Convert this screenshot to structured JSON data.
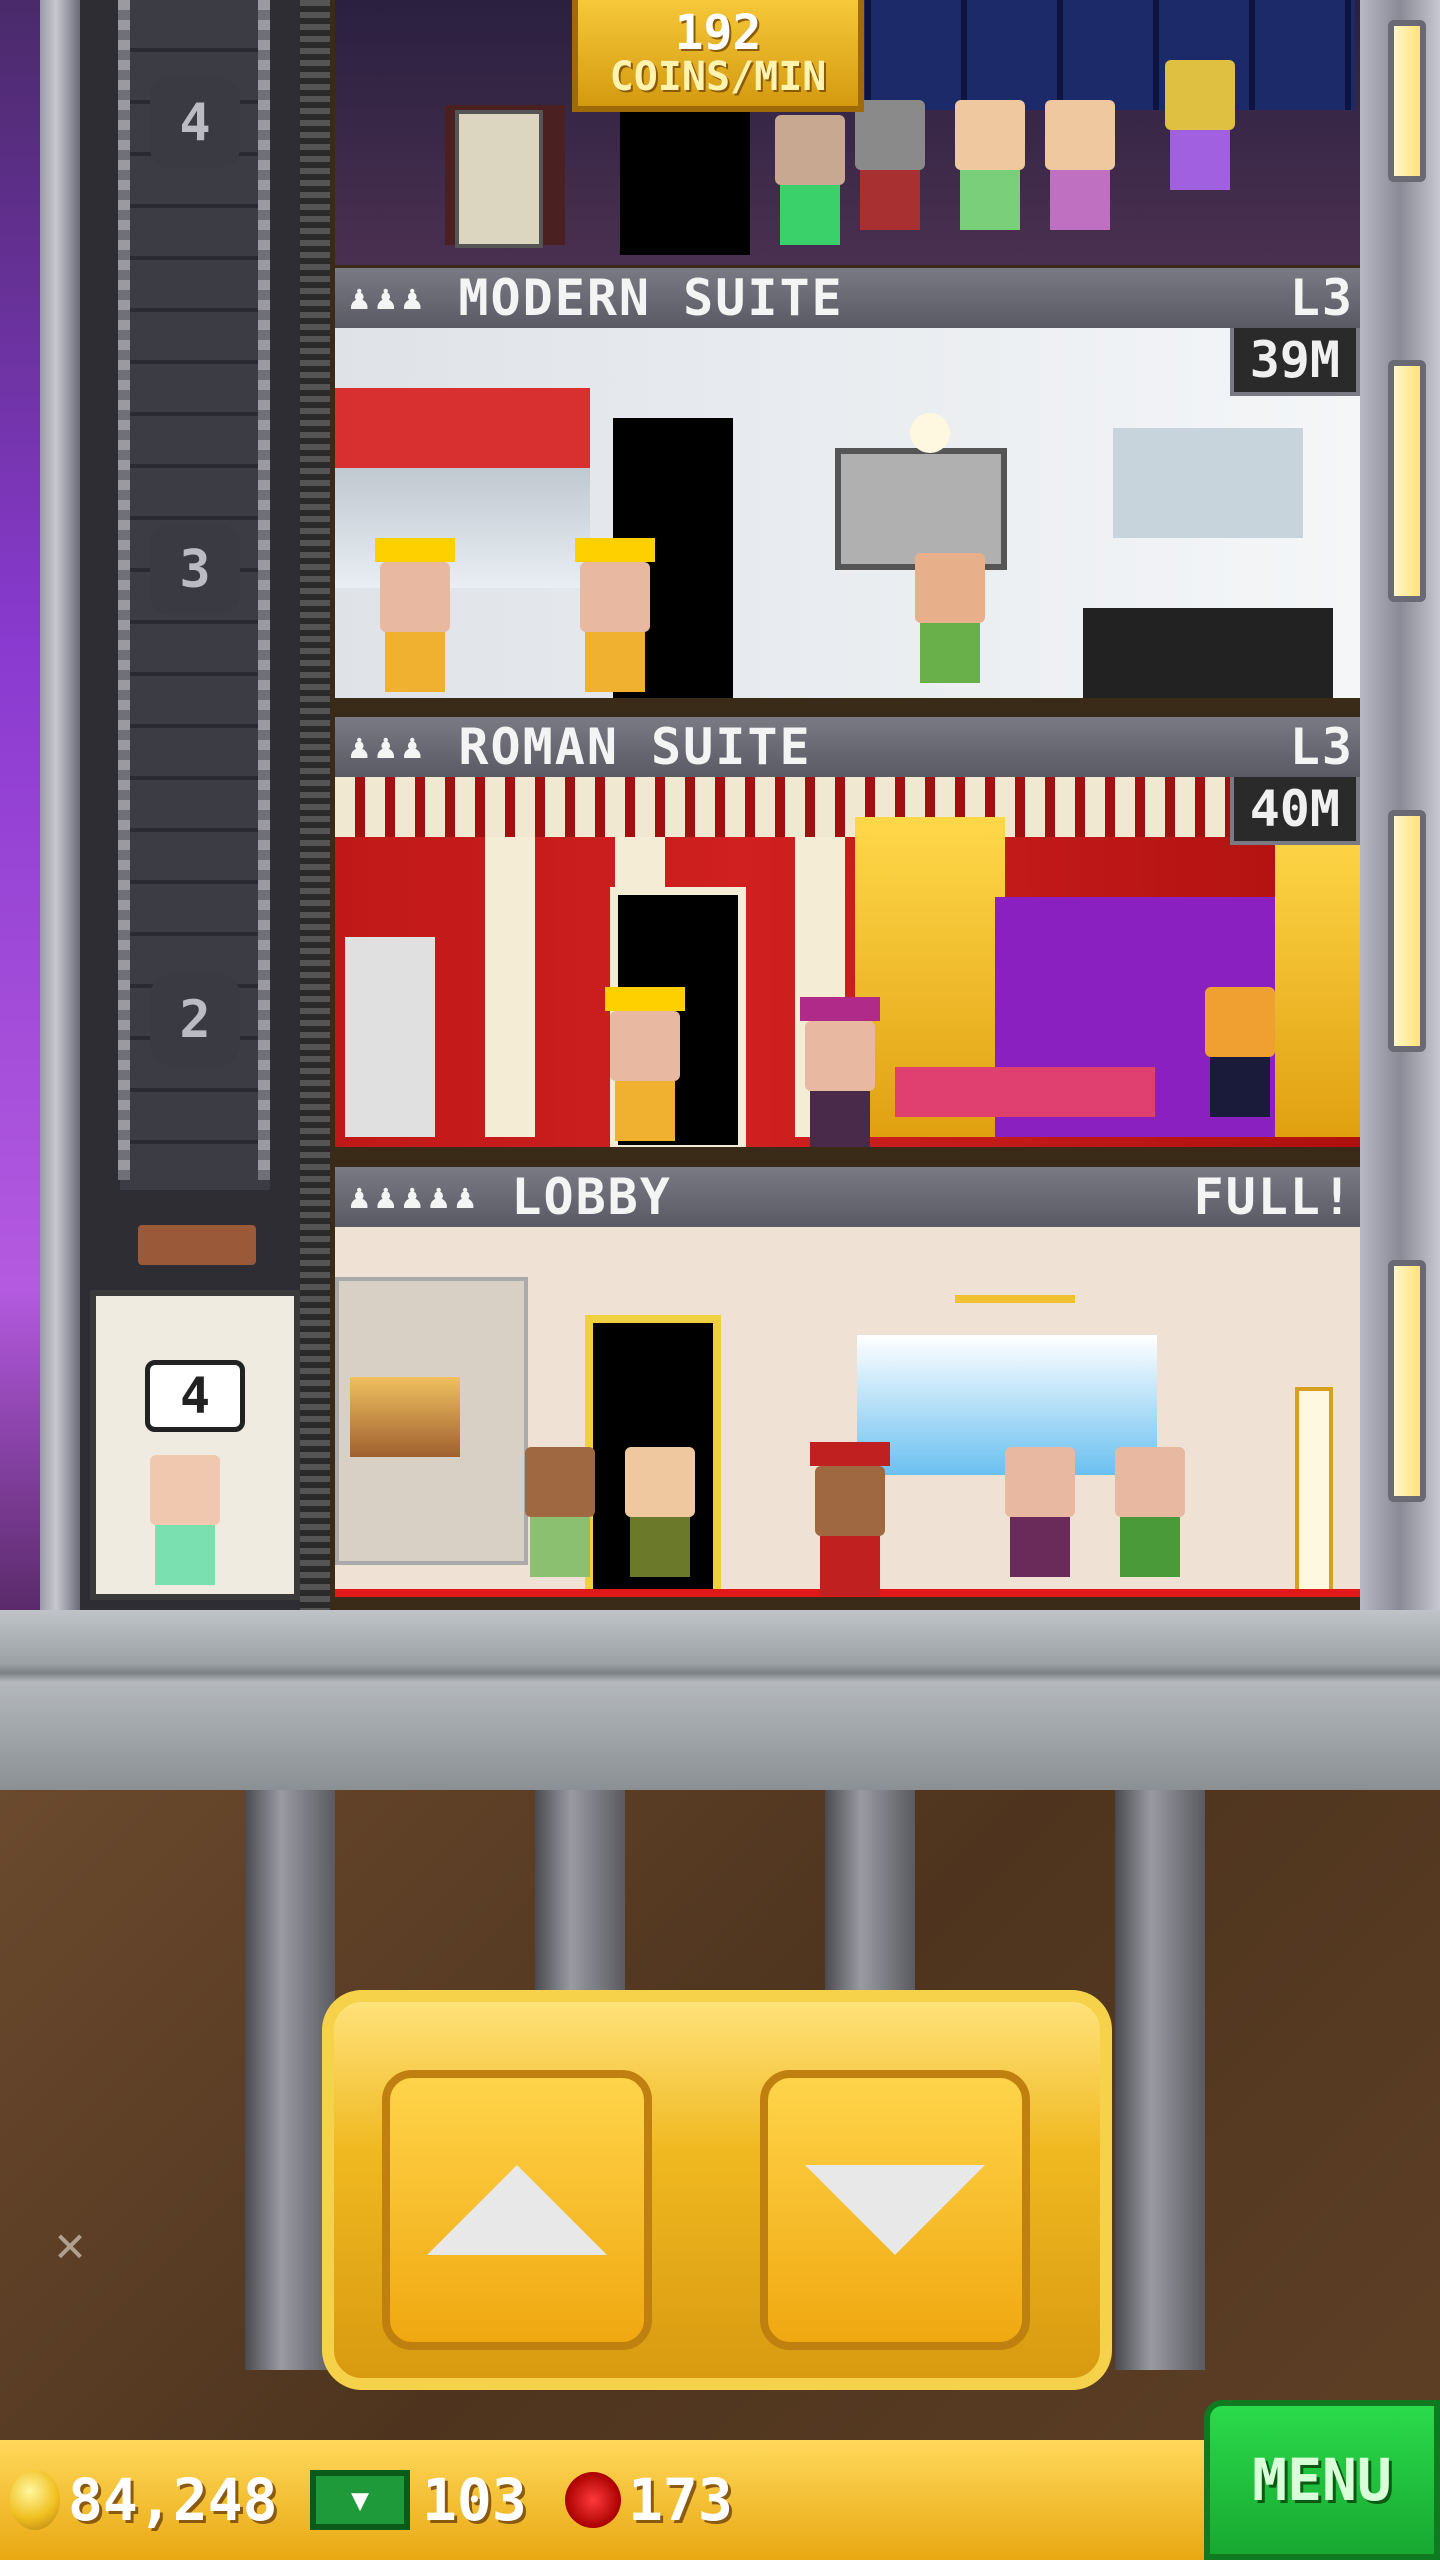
{
  "banner": {
    "coins_value": "192",
    "coins_unit": "COINS/MIN"
  },
  "shaft": {
    "floor_numbers": [
      "4",
      "3",
      "2"
    ],
    "car_floor": "4"
  },
  "floors": [
    {
      "name": "MODERN SUITE",
      "level": "L3",
      "income": "39M",
      "occupants": 3
    },
    {
      "name": "ROMAN SUITE",
      "level": "L3",
      "income": "40M",
      "occupants": 3
    },
    {
      "name": "LOBBY",
      "level": "FULL!",
      "occupants": 5
    }
  ],
  "hud": {
    "coins": "84,248",
    "bux": "103",
    "gems": "173",
    "menu_label": "MENU"
  },
  "colors": {
    "hud_gold": "#e8a812",
    "menu_green": "#18a832",
    "control_gold": "#f0b820"
  }
}
